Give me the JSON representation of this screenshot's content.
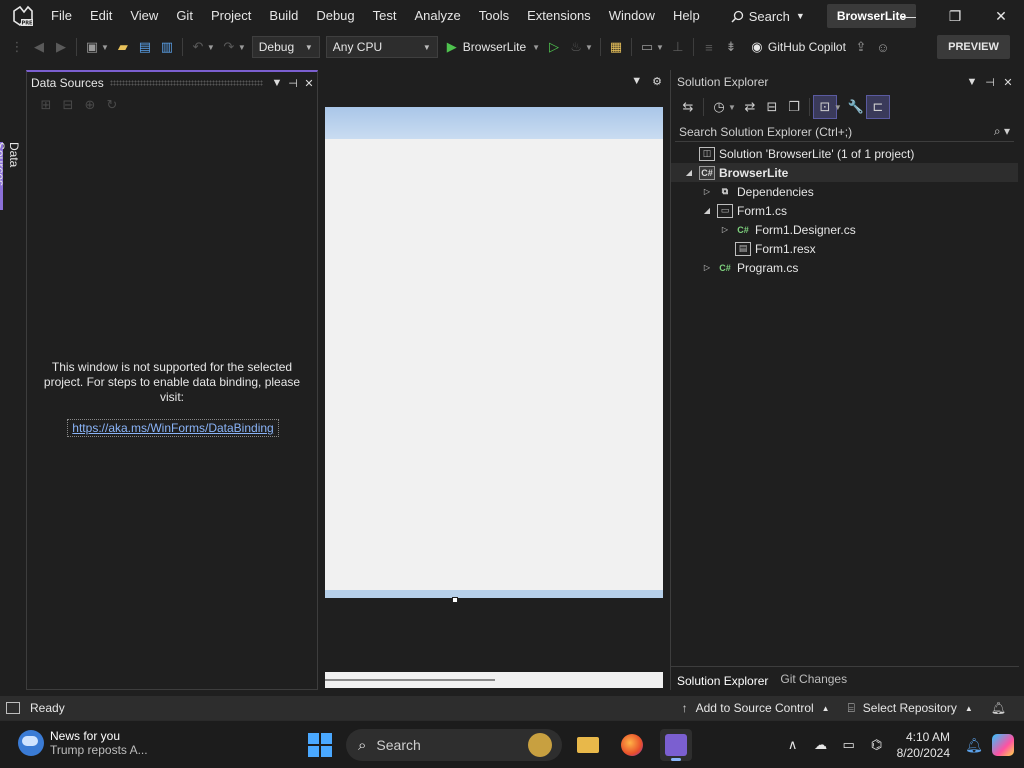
{
  "menu": {
    "items": [
      "File",
      "Edit",
      "View",
      "Git",
      "Project",
      "Build",
      "Debug",
      "Test",
      "Analyze",
      "Tools",
      "Extensions",
      "Window",
      "Help"
    ],
    "search_label": "Search",
    "project_name": "BrowserLite"
  },
  "toolbar": {
    "config": "Debug",
    "platform": "Any CPU",
    "run_label": "BrowserLite",
    "copilot_label": "GitHub Copilot",
    "preview_label": "PREVIEW"
  },
  "data_sources": {
    "tab_label": "Data Sources",
    "title": "Data Sources",
    "message": "This window is not supported for the selected project. For steps to enable data binding, please visit:",
    "link": "https://aka.ms/WinForms/DataBinding"
  },
  "solution_explorer": {
    "title": "Solution Explorer",
    "search_placeholder": "Search Solution Explorer (Ctrl+;)",
    "tree": [
      {
        "label": "Solution 'BrowserLite' (1 of 1 project)",
        "icon": "solution-icon",
        "level": 0,
        "expander": "",
        "bold": false
      },
      {
        "label": "BrowserLite",
        "icon": "csharp-project-icon",
        "level": 0,
        "expander": "expanded",
        "bold": true
      },
      {
        "label": "Dependencies",
        "icon": "dependencies-icon",
        "level": 1,
        "expander": "collapsed",
        "bold": false
      },
      {
        "label": "Form1.cs",
        "icon": "form-icon",
        "level": 1,
        "expander": "expanded",
        "bold": false
      },
      {
        "label": "Form1.Designer.cs",
        "icon": "csharp-file-icon",
        "level": 2,
        "expander": "collapsed",
        "bold": false
      },
      {
        "label": "Form1.resx",
        "icon": "resx-file-icon",
        "level": 2,
        "expander": "",
        "bold": false
      },
      {
        "label": "Program.cs",
        "icon": "csharp-file-icon",
        "level": 1,
        "expander": "collapsed",
        "bold": false
      }
    ],
    "bottom_tabs": [
      "Solution Explorer",
      "Git Changes"
    ]
  },
  "statusbar": {
    "ready": "Ready",
    "add_source_control": "Add to Source Control",
    "select_repository": "Select Repository"
  },
  "taskbar": {
    "news_title": "News for you",
    "news_sub": "Trump reposts A...",
    "search_placeholder": "Search",
    "time": "4:10 AM",
    "date": "8/20/2024"
  },
  "colors": {
    "accent": "#8b70d8",
    "background": "#1f1f1f",
    "link": "#8ab4f8",
    "run_green": "#4ec24e"
  }
}
